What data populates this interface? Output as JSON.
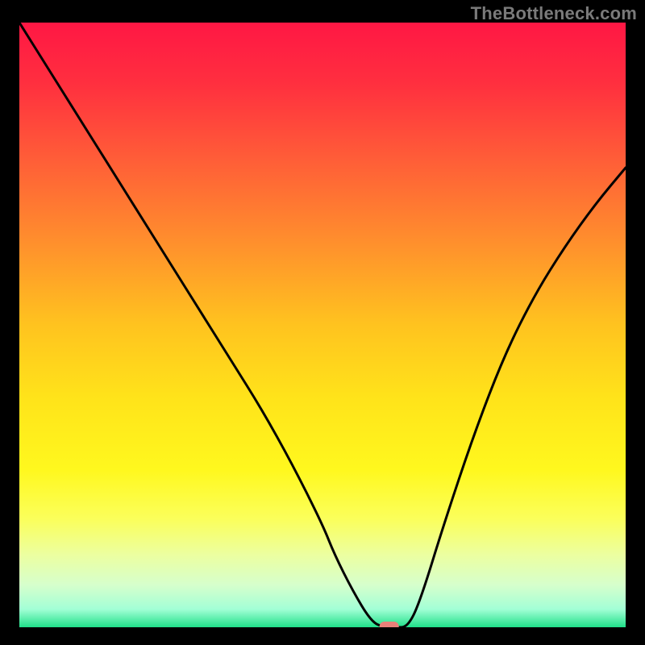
{
  "attribution": "TheBottleneck.com",
  "chart_data": {
    "type": "line",
    "title": "",
    "xlabel": "",
    "ylabel": "",
    "xlim": [
      0,
      100
    ],
    "ylim": [
      0,
      100
    ],
    "grid": false,
    "legend": false,
    "background_gradient": {
      "stops": [
        {
          "pos": 0.0,
          "color": "#ff1744"
        },
        {
          "pos": 0.1,
          "color": "#ff2f3f"
        },
        {
          "pos": 0.22,
          "color": "#ff5b38"
        },
        {
          "pos": 0.35,
          "color": "#ff8a2e"
        },
        {
          "pos": 0.5,
          "color": "#ffc31f"
        },
        {
          "pos": 0.62,
          "color": "#ffe31a"
        },
        {
          "pos": 0.74,
          "color": "#fff81e"
        },
        {
          "pos": 0.82,
          "color": "#fbff5a"
        },
        {
          "pos": 0.88,
          "color": "#ecffa0"
        },
        {
          "pos": 0.93,
          "color": "#d6ffcc"
        },
        {
          "pos": 0.97,
          "color": "#a3ffd6"
        },
        {
          "pos": 1.0,
          "color": "#20e089"
        }
      ]
    },
    "curve": {
      "x": [
        0,
        5,
        10,
        15,
        20,
        25,
        30,
        35,
        40,
        45,
        50,
        52,
        55,
        58,
        60,
        62,
        64,
        66,
        70,
        75,
        80,
        85,
        90,
        95,
        100
      ],
      "values": [
        100,
        92,
        84,
        76,
        68,
        60,
        52,
        44,
        36,
        27,
        17,
        12,
        6,
        1,
        0,
        0,
        0,
        4,
        17,
        32,
        45,
        55,
        63,
        70,
        76
      ]
    },
    "marker": {
      "x": 61,
      "y": 0,
      "color": "#e98079"
    }
  }
}
